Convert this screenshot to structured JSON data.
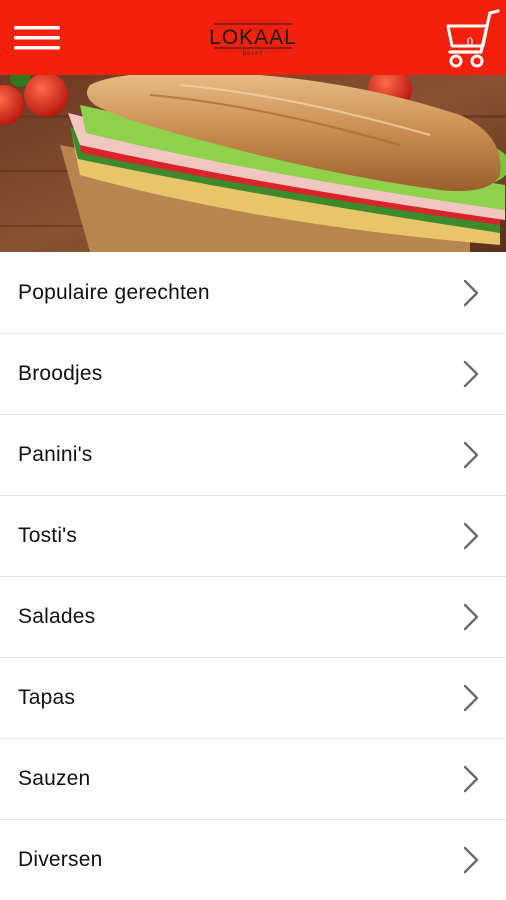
{
  "header": {
    "background_color": "#f2200c",
    "menu_icon": "hamburger-icon",
    "logo": {
      "name": "LOKAAL",
      "sub": "DELFT"
    },
    "cart": {
      "icon": "shopping-cart-icon",
      "count": "0"
    }
  },
  "hero": {
    "image": "sandwich-photo"
  },
  "menu": {
    "chevron_icon": "chevron-right-icon",
    "items": [
      {
        "label": "Populaire gerechten"
      },
      {
        "label": "Broodjes"
      },
      {
        "label": "Panini's"
      },
      {
        "label": "Tosti's"
      },
      {
        "label": "Salades"
      },
      {
        "label": "Tapas"
      },
      {
        "label": "Sauzen"
      },
      {
        "label": "Diversen"
      }
    ]
  }
}
